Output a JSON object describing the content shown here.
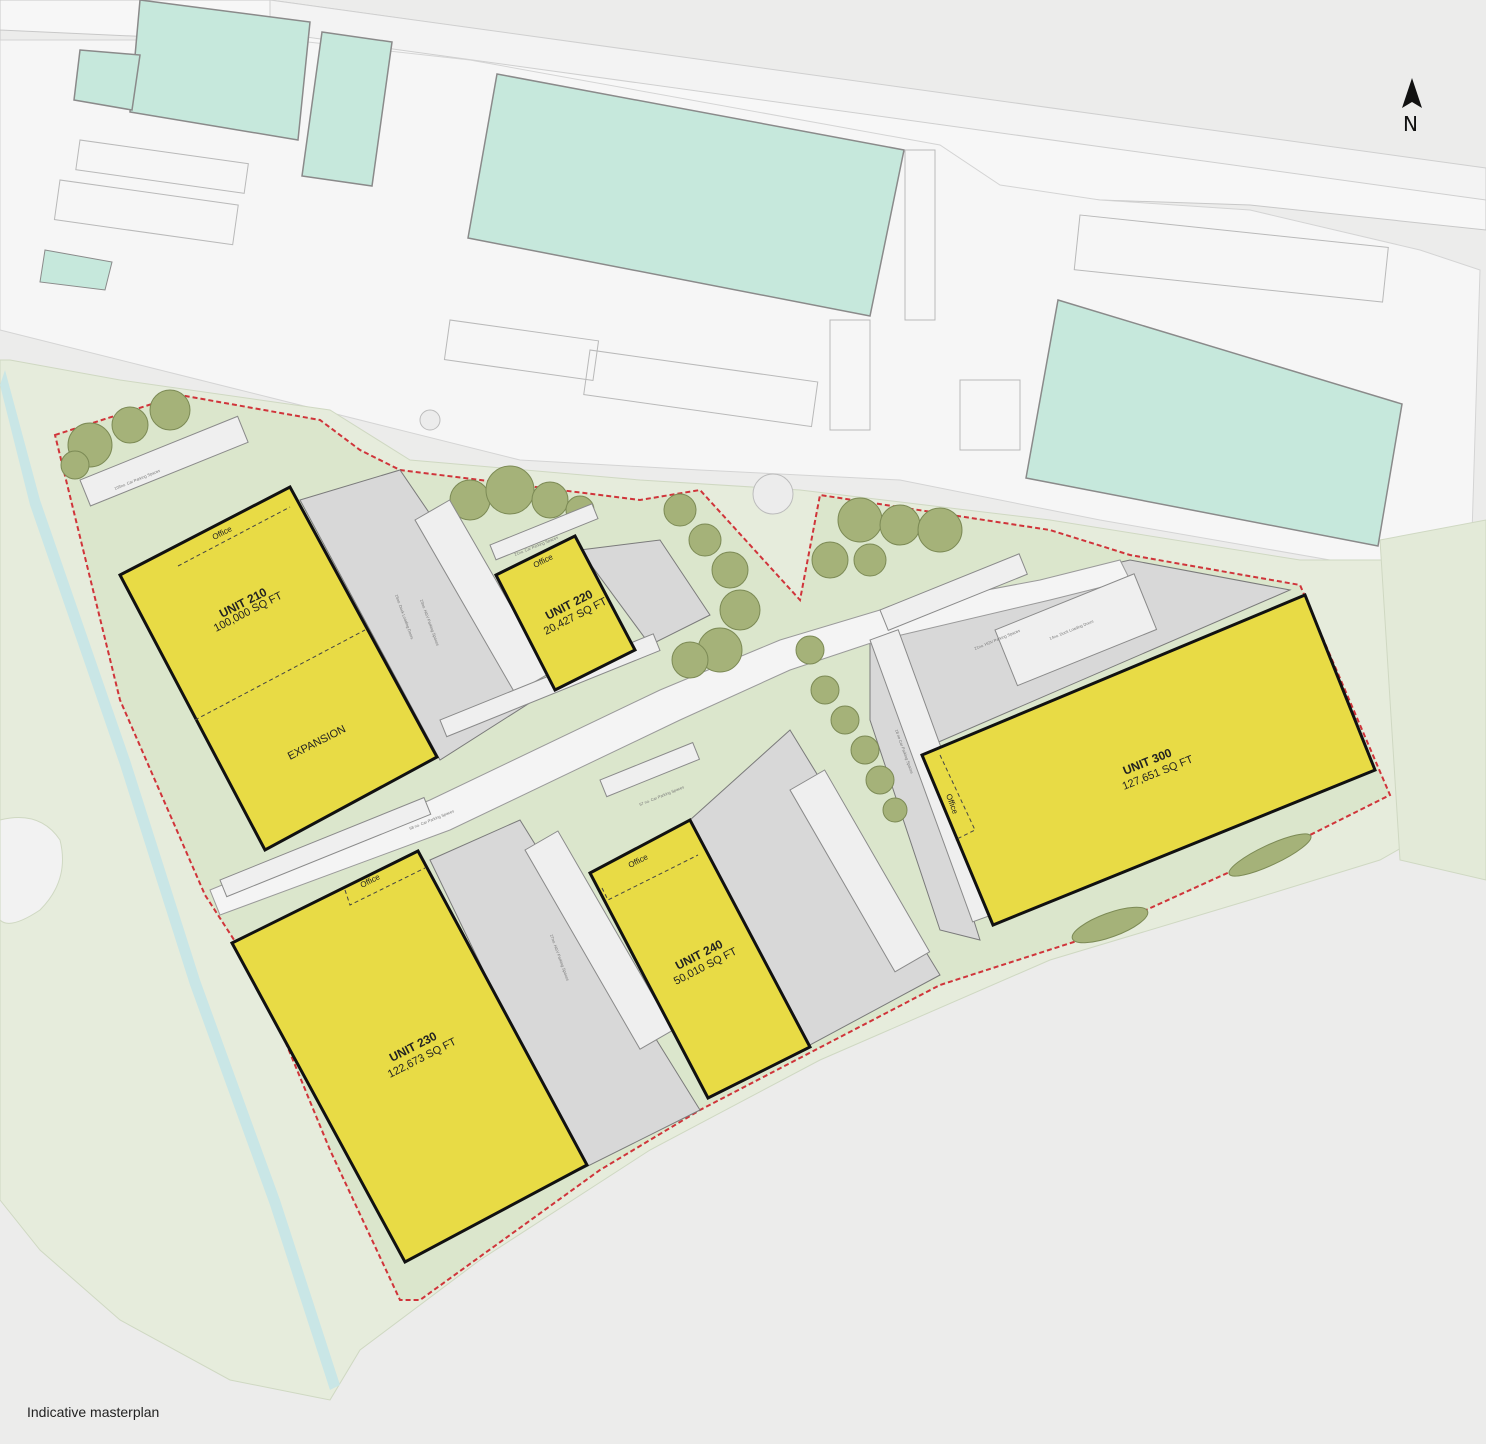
{
  "caption": "Indicative masterplan",
  "north_label": "N",
  "colors": {
    "unit_fill": "#e8db45",
    "landscape": "#dde8d2",
    "existing_building": "#c7e7db",
    "yard": "#d7d7d7",
    "boundary": "#d0343a",
    "trees": "#a7b37a",
    "water": "#bfe3e3"
  },
  "units": {
    "unit210": {
      "title": "UNIT 210",
      "area": "100,000 SQ FT",
      "office": "Office",
      "expansion": "EXPANSION"
    },
    "unit220": {
      "title": "UNIT 220",
      "area": "20,427 SQ FT",
      "office": "Office"
    },
    "unit230": {
      "title": "UNIT 230",
      "area": "122,673 SQ FT",
      "office": "Office"
    },
    "unit240": {
      "title": "UNIT 240",
      "area": "50,010 SQ FT",
      "office": "Office"
    },
    "unit300": {
      "title": "UNIT 300",
      "area": "127,651 SQ FT",
      "office": "Office"
    }
  },
  "parking_labels": {
    "p1": "103no. Car Parking Spaces",
    "p2": "21no. Car Parking Spaces",
    "p3": "58 no. Car Parking Spaces",
    "p4": "57 no. Car Parking Spaces",
    "p5": "21no. HGV Parking Spaces",
    "p6": "23no. HGV Parking Spaces",
    "p7": "27no. HGV Parking Spaces",
    "p8": "18 no Car Parking Spaces",
    "p9": "14no. Dock Loading Doors",
    "p10": "15no. Dock Loading Doors"
  },
  "icons": {
    "north_arrow": "north-arrow-icon"
  }
}
